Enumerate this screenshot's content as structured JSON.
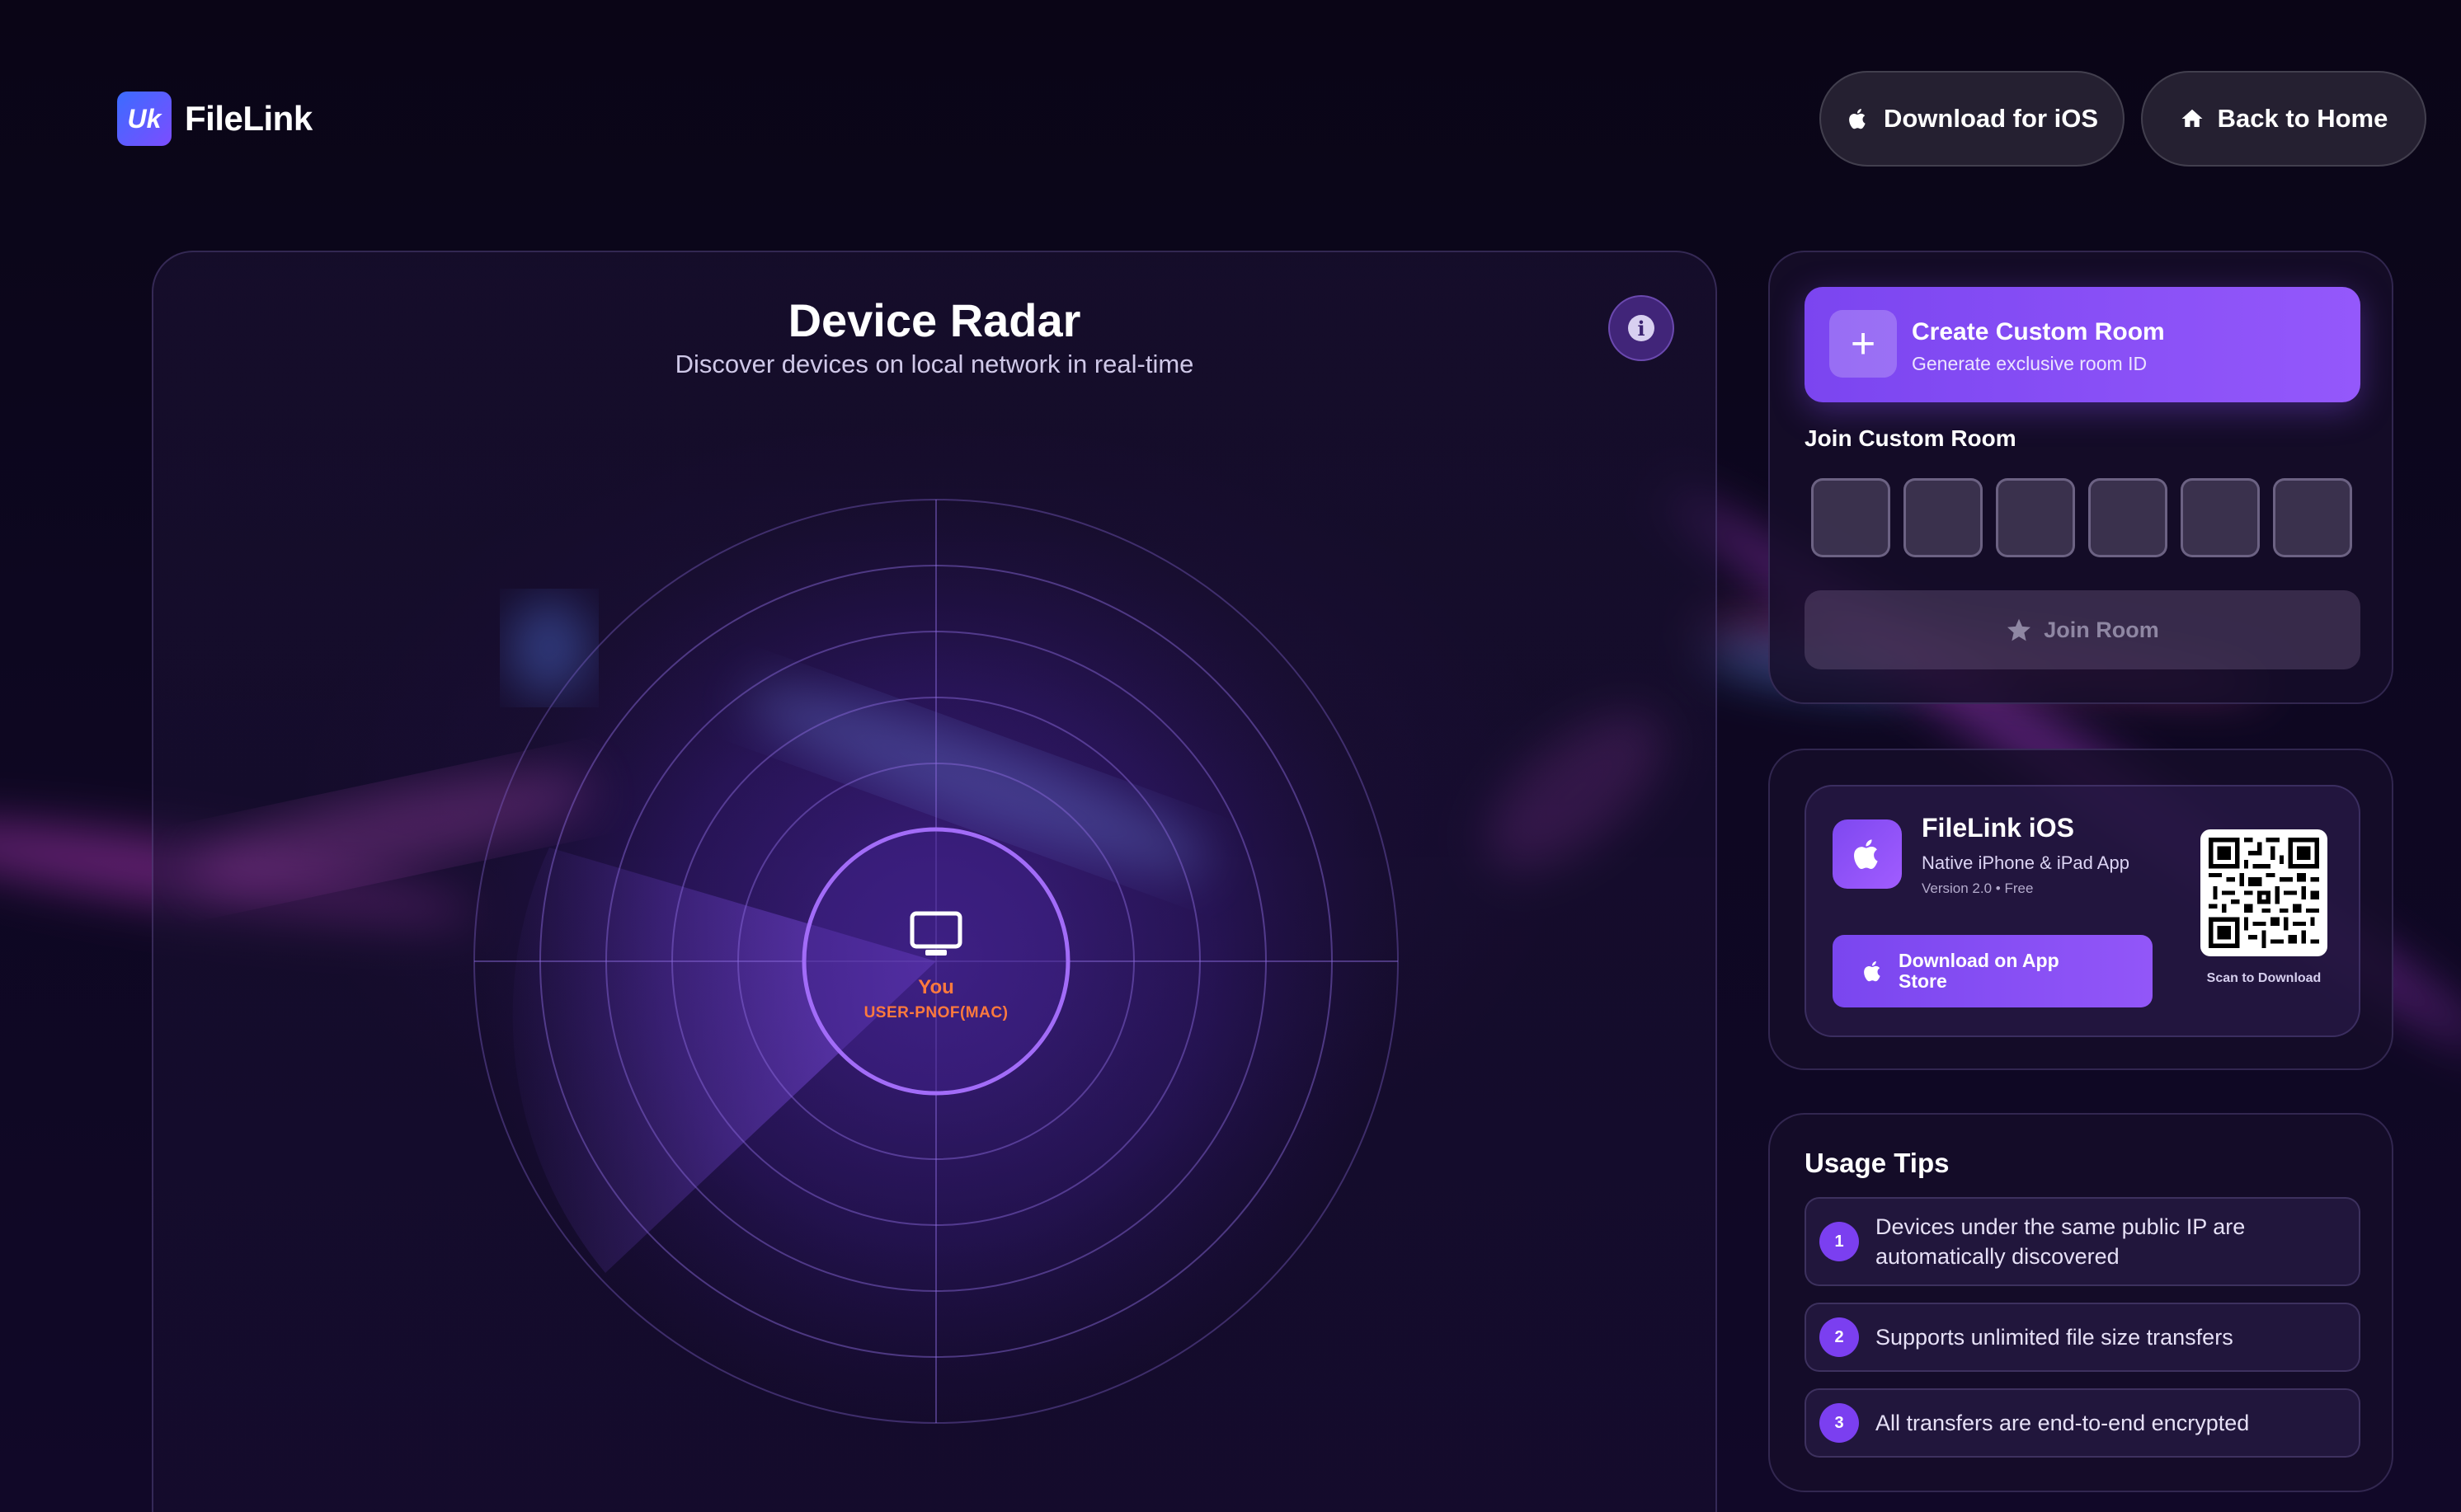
{
  "brand": {
    "logo_glyph": "Uk",
    "name": "FileLink"
  },
  "header": {
    "download_ios_label": "Download for iOS",
    "back_home_label": "Back to Home"
  },
  "radar": {
    "title": "Device Radar",
    "subtitle": "Discover devices on local network in real-time",
    "info_icon": "i",
    "self_device": {
      "label": "You",
      "hostname": "USER-PNOF(MAC)",
      "icon": "monitor-icon"
    }
  },
  "room": {
    "create_plus": "+",
    "create_title": "Create Custom Room",
    "create_subtitle": "Generate exclusive room ID",
    "join_label": "Join Custom Room",
    "code_slots": [
      "",
      "",
      "",
      "",
      "",
      ""
    ],
    "join_button_label": "Join Room"
  },
  "app": {
    "name": "FileLink iOS",
    "description": "Native iPhone & iPad App",
    "version": "Version 2.0 • Free",
    "download_label": "Download on App Store",
    "qr_caption": "Scan to Download"
  },
  "tips": {
    "title": "Usage Tips",
    "items": [
      {
        "num": "1",
        "text": "Devices under the same public IP are automatically discovered"
      },
      {
        "num": "2",
        "text": "Supports unlimited file size transfers"
      },
      {
        "num": "3",
        "text": "All transfers are end-to-end encrypted"
      }
    ]
  },
  "colors": {
    "accent": "#8b50f6",
    "self_label": "#ff7a3d",
    "background": "#0b0618"
  }
}
